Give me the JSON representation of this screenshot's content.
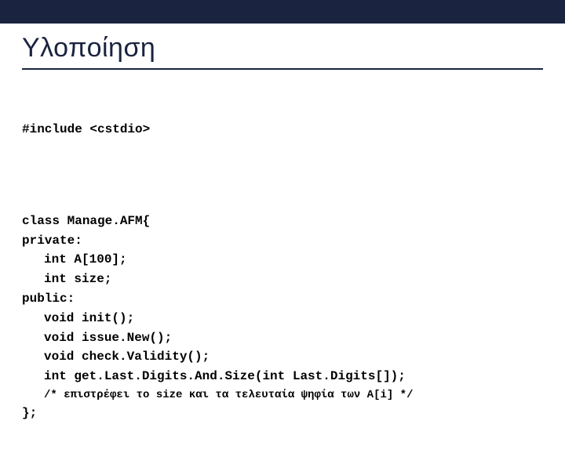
{
  "slide": {
    "title": "Υλοποίηση"
  },
  "code": {
    "include": "#include <cstdio>",
    "class_decl": "class Manage.AFM{",
    "private_label": "private:",
    "arr_decl": "int A[100];",
    "size_decl": "int size;",
    "public_label": "public:",
    "init_decl": "void init();",
    "issue_decl": "void issue.New();",
    "check_decl": "void check.Validity();",
    "get_decl": "int get.Last.Digits.And.Size(int Last.Digits[]);",
    "comment": "/* επιστρέφει το size και τα τελευταία ψηφία των A[i] */",
    "close": "};"
  }
}
